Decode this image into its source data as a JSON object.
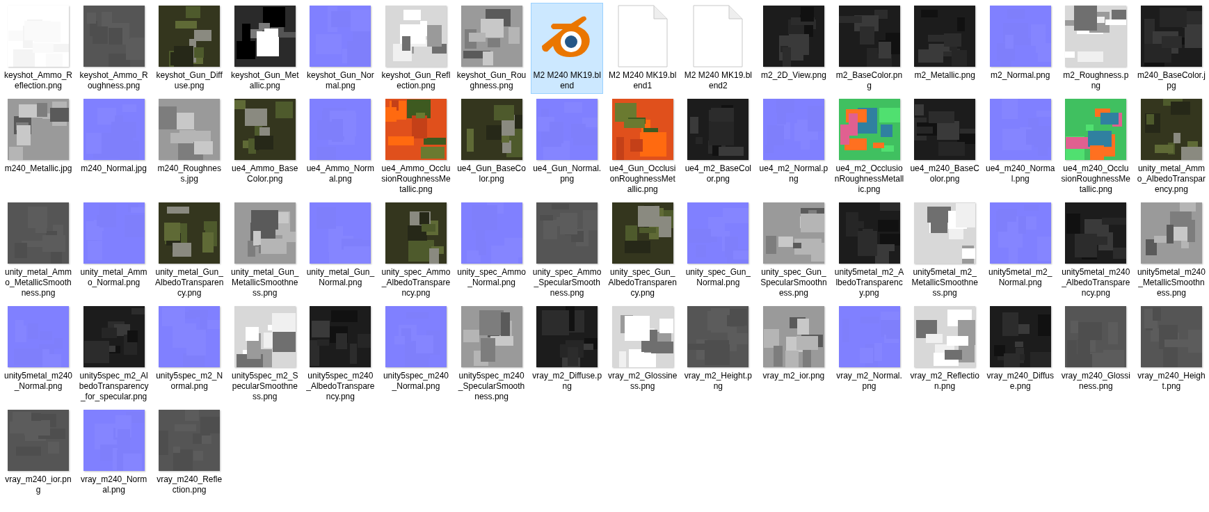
{
  "files": [
    {
      "name": "keyshot_Ammo_Reflection.png",
      "kind": "white",
      "selected": false
    },
    {
      "name": "keyshot_Ammo_Roughness.png",
      "kind": "gray",
      "selected": false
    },
    {
      "name": "keyshot_Gun_Diffuse.png",
      "kind": "olive",
      "selected": false
    },
    {
      "name": "keyshot_Gun_Metallic.png",
      "kind": "mask",
      "selected": false
    },
    {
      "name": "keyshot_Gun_Normal.png",
      "kind": "normal",
      "selected": false
    },
    {
      "name": "keyshot_Gun_Reflection.png",
      "kind": "light",
      "selected": false
    },
    {
      "name": "keyshot_Gun_Roughness.png",
      "kind": "lightgray",
      "selected": false
    },
    {
      "name": "M2 M240 MK19.blend",
      "kind": "blend",
      "selected": true
    },
    {
      "name": "M2 M240 MK19.blend1",
      "kind": "document",
      "selected": false
    },
    {
      "name": "M2 M240 MK19.blend2",
      "kind": "document",
      "selected": false
    },
    {
      "name": "m2_2D_View.png",
      "kind": "dark",
      "selected": false
    },
    {
      "name": "m2_BaseColor.png",
      "kind": "dark",
      "selected": false
    },
    {
      "name": "m2_Metallic.png",
      "kind": "dark",
      "selected": false
    },
    {
      "name": "m2_Normal.png",
      "kind": "normal",
      "selected": false
    },
    {
      "name": "m2_Roughness.png",
      "kind": "light",
      "selected": false
    },
    {
      "name": "m240_BaseColor.jpg",
      "kind": "dark",
      "selected": false
    },
    {
      "name": "m240_Metallic.jpg",
      "kind": "lightgray",
      "selected": false
    },
    {
      "name": "m240_Normal.jpg",
      "kind": "normal",
      "selected": false
    },
    {
      "name": "m240_Roughness.jpg",
      "kind": "lightgray",
      "selected": false
    },
    {
      "name": "ue4_Ammo_BaseColor.png",
      "kind": "olive",
      "selected": false
    },
    {
      "name": "ue4_Ammo_Normal.png",
      "kind": "normal",
      "selected": false
    },
    {
      "name": "ue4_Ammo_OcclusionRoughnessMetallic.png",
      "kind": "orange",
      "selected": false
    },
    {
      "name": "ue4_Gun_BaseColor.png",
      "kind": "olive",
      "selected": false
    },
    {
      "name": "ue4_Gun_Normal.png",
      "kind": "normal",
      "selected": false
    },
    {
      "name": "ue4_Gun_OcclusionRoughnessMetallic.png",
      "kind": "orange",
      "selected": false
    },
    {
      "name": "ue4_m2_BaseColor.png",
      "kind": "dark",
      "selected": false
    },
    {
      "name": "ue4_m2_Normal.png",
      "kind": "normal",
      "selected": false
    },
    {
      "name": "ue4_m2_OcclusionRoughnessMetallic.png",
      "kind": "multicolor",
      "selected": false
    },
    {
      "name": "ue4_m240_BaseColor.png",
      "kind": "dark",
      "selected": false
    },
    {
      "name": "ue4_m240_Normal.png",
      "kind": "normal",
      "selected": false
    },
    {
      "name": "ue4_m240_OcclusionRoughnessMetallic.png",
      "kind": "multicolor",
      "selected": false
    },
    {
      "name": "unity_metal_Ammo_AlbedoTransparency.png",
      "kind": "olive",
      "selected": false
    },
    {
      "name": "unity_metal_Ammo_MetallicSmoothness.png",
      "kind": "gray",
      "selected": false
    },
    {
      "name": "unity_metal_Ammo_Normal.png",
      "kind": "normal",
      "selected": false
    },
    {
      "name": "unity_metal_Gun_AlbedoTransparency.png",
      "kind": "olive",
      "selected": false
    },
    {
      "name": "unity_metal_Gun_MetallicSmoothness.png",
      "kind": "lightgray",
      "selected": false
    },
    {
      "name": "unity_metal_Gun_Normal.png",
      "kind": "normal",
      "selected": false
    },
    {
      "name": "unity_spec_Ammo_AlbedoTransparency.png",
      "kind": "olive",
      "selected": false
    },
    {
      "name": "unity_spec_Ammo_Normal.png",
      "kind": "normal",
      "selected": false
    },
    {
      "name": "unity_spec_Ammo_SpecularSmoothness.png",
      "kind": "gray",
      "selected": false
    },
    {
      "name": "unity_spec_Gun_AlbedoTransparency.png",
      "kind": "olive",
      "selected": false
    },
    {
      "name": "unity_spec_Gun_Normal.png",
      "kind": "normal",
      "selected": false
    },
    {
      "name": "unity_spec_Gun_SpecularSmoothness.png",
      "kind": "lightgray",
      "selected": false
    },
    {
      "name": "unity5metal_m2_AlbedoTransparency.png",
      "kind": "dark",
      "selected": false
    },
    {
      "name": "unity5metal_m2_MetallicSmoothness.png",
      "kind": "light",
      "selected": false
    },
    {
      "name": "unity5metal_m2_Normal.png",
      "kind": "normal",
      "selected": false
    },
    {
      "name": "unity5metal_m240_AlbedoTransparency.png",
      "kind": "dark",
      "selected": false
    },
    {
      "name": "unity5metal_m240_MetallicSmoothness.png",
      "kind": "lightgray",
      "selected": false
    },
    {
      "name": "unity5metal_m240_Normal.png",
      "kind": "normal",
      "selected": false
    },
    {
      "name": "unity5spec_m2_AlbedoTransparency_for_specular.png",
      "kind": "dark",
      "selected": false
    },
    {
      "name": "unity5spec_m2_Normal.png",
      "kind": "normal",
      "selected": false
    },
    {
      "name": "unity5spec_m2_SpecularSmoothness.png",
      "kind": "light",
      "selected": false
    },
    {
      "name": "unity5spec_m240_AlbedoTransparency.png",
      "kind": "dark",
      "selected": false
    },
    {
      "name": "unity5spec_m240_Normal.png",
      "kind": "normal",
      "selected": false
    },
    {
      "name": "unity5spec_m240_SpecularSmoothness.png",
      "kind": "lightgray",
      "selected": false
    },
    {
      "name": "vray_m2_Diffuse.png",
      "kind": "dark",
      "selected": false
    },
    {
      "name": "vray_m2_Glossiness.png",
      "kind": "light",
      "selected": false
    },
    {
      "name": "vray_m2_Height.png",
      "kind": "gray",
      "selected": false
    },
    {
      "name": "vray_m2_ior.png",
      "kind": "lightgray",
      "selected": false
    },
    {
      "name": "vray_m2_Normal.png",
      "kind": "normal",
      "selected": false
    },
    {
      "name": "vray_m2_Reflection.png",
      "kind": "light",
      "selected": false
    },
    {
      "name": "vray_m240_Diffuse.png",
      "kind": "dark",
      "selected": false
    },
    {
      "name": "vray_m240_Glossiness.png",
      "kind": "gray",
      "selected": false
    },
    {
      "name": "vray_m240_Height.png",
      "kind": "gray",
      "selected": false
    },
    {
      "name": "vray_m240_ior.png",
      "kind": "gray",
      "selected": false
    },
    {
      "name": "vray_m240_Normal.png",
      "kind": "normal",
      "selected": false
    },
    {
      "name": "vray_m240_Reflection.png",
      "kind": "gray",
      "selected": false
    }
  ]
}
